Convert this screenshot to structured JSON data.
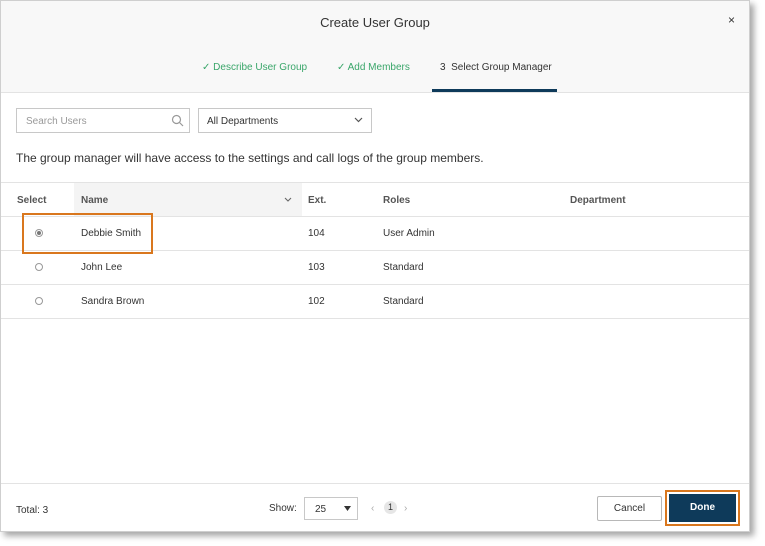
{
  "dialog": {
    "title": "Create User Group",
    "close_glyph": "×"
  },
  "steps": [
    {
      "label": "✓ Describe User Group",
      "state": "done"
    },
    {
      "label": "✓ Add Members",
      "state": "done"
    },
    {
      "label": "3  Select Group Manager",
      "state": "active"
    }
  ],
  "search": {
    "placeholder": "Search Users",
    "value": ""
  },
  "department_filter": {
    "selected": "All Departments"
  },
  "description": "The group manager will have access to the settings and call logs of the group members.",
  "table": {
    "columns": {
      "select": "Select",
      "name": "Name",
      "ext": "Ext.",
      "roles": "Roles",
      "department": "Department"
    },
    "rows": [
      {
        "name": "Debbie Smith",
        "ext": "104",
        "role": "User Admin",
        "department": "",
        "selected": true
      },
      {
        "name": "John Lee",
        "ext": "103",
        "role": "Standard",
        "department": "",
        "selected": false
      },
      {
        "name": "Sandra Brown",
        "ext": "102",
        "role": "Standard",
        "department": "",
        "selected": false
      }
    ]
  },
  "footer": {
    "total_label": "Total: 3",
    "show_label": "Show:",
    "page_size": "25",
    "current_page": "1",
    "prev_glyph": "‹",
    "next_glyph": "›",
    "cancel_label": "Cancel",
    "done_label": "Done"
  },
  "colors": {
    "accent": "#0e3a5a",
    "done_step": "#3aa66a",
    "highlight": "#d9771e"
  }
}
